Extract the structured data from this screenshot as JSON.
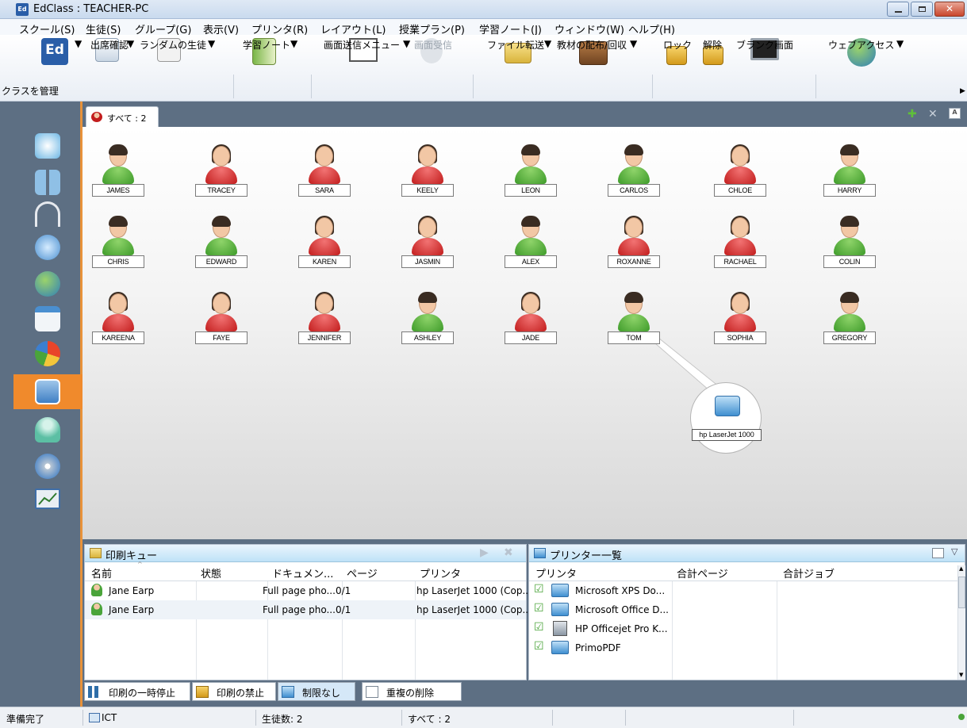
{
  "window": {
    "title": "EdClass : TEACHER-PC",
    "app_icon_text": "Ed"
  },
  "menu": [
    "スクール(S)",
    "生徒(S)",
    "グループ(G)",
    "表示(V)",
    "プリンタ(R)",
    "レイアウト(L)",
    "授業プラン(P)",
    "学習ノート(J)",
    "ウィンドウ(W)",
    "ヘルプ(H)"
  ],
  "toolbar": {
    "manage_class": "クラスを管理",
    "attendance": "出席確認",
    "random_student": "ランダムの生徒",
    "learning_note": "学習ノート",
    "screen_send_menu": "画面送信メニュー",
    "screen_receive": "画面受信",
    "file_transfer": "ファイル転送",
    "distribute_collect": "教材の配布/回収",
    "lock": "ロック",
    "unlock": "解除",
    "blank_screen": "ブランク画面",
    "web_access": "ウェブアクセス"
  },
  "tab": {
    "label": "すべて : 2"
  },
  "students": [
    {
      "name": "JAMES",
      "color": "green"
    },
    {
      "name": "TRACEY",
      "color": "red"
    },
    {
      "name": "SARA",
      "color": "red"
    },
    {
      "name": "KEELY",
      "color": "red"
    },
    {
      "name": "LEON",
      "color": "green"
    },
    {
      "name": "CARLOS",
      "color": "green"
    },
    {
      "name": "CHLOE",
      "color": "red"
    },
    {
      "name": "HARRY",
      "color": "green"
    },
    {
      "name": "CHRIS",
      "color": "green"
    },
    {
      "name": "EDWARD",
      "color": "green"
    },
    {
      "name": "KAREN",
      "color": "red"
    },
    {
      "name": "JASMIN",
      "color": "red"
    },
    {
      "name": "ALEX",
      "color": "green"
    },
    {
      "name": "ROXANNE",
      "color": "red"
    },
    {
      "name": "RACHAEL",
      "color": "red"
    },
    {
      "name": "COLIN",
      "color": "green"
    },
    {
      "name": "KAREENA",
      "color": "red"
    },
    {
      "name": "FAYE",
      "color": "red"
    },
    {
      "name": "JENNIFER",
      "color": "red"
    },
    {
      "name": "ASHLEY",
      "color": "green"
    },
    {
      "name": "JADE",
      "color": "red"
    },
    {
      "name": "TOM",
      "color": "green"
    },
    {
      "name": "SOPHIA",
      "color": "red"
    },
    {
      "name": "GREGORY",
      "color": "green"
    }
  ],
  "printer_node": {
    "label": "hp LaserJet 1000"
  },
  "print_queue": {
    "title": "印刷キュー",
    "columns": [
      "名前",
      "状態",
      "ドキュメン...",
      "ページ",
      "プリンタ"
    ],
    "rows": [
      {
        "name": "Jane Earp",
        "status": "",
        "document": "Full page pho...",
        "pages": "0/1",
        "printer": "hp LaserJet 1000 (Cop..."
      },
      {
        "name": "Jane Earp",
        "status": "",
        "document": "Full page pho...",
        "pages": "0/1",
        "printer": "hp LaserJet 1000 (Cop..."
      }
    ],
    "buttons": {
      "pause": "印刷の一時停止",
      "block": "印刷の禁止",
      "unlimited": "制限なし",
      "remove_duplicates": "重複の削除"
    }
  },
  "printer_list": {
    "title": "プリンター一覧",
    "columns": [
      "プリンタ",
      "合計ページ",
      "合計ジョブ"
    ],
    "rows": [
      {
        "name": "Microsoft XPS Do..."
      },
      {
        "name": "Microsoft Office D..."
      },
      {
        "name": "HP Officejet Pro K..."
      },
      {
        "name": "PrimoPDF"
      }
    ]
  },
  "status": {
    "ready": "準備完了",
    "room": "ICT",
    "student_count": "生徒数: 2",
    "all": "すべて : 2"
  },
  "colors": {
    "sidebar": "#5d6f83",
    "accent_orange": "#f08a2c",
    "student_green": "#3e9b2a",
    "student_red": "#c21d1d"
  }
}
